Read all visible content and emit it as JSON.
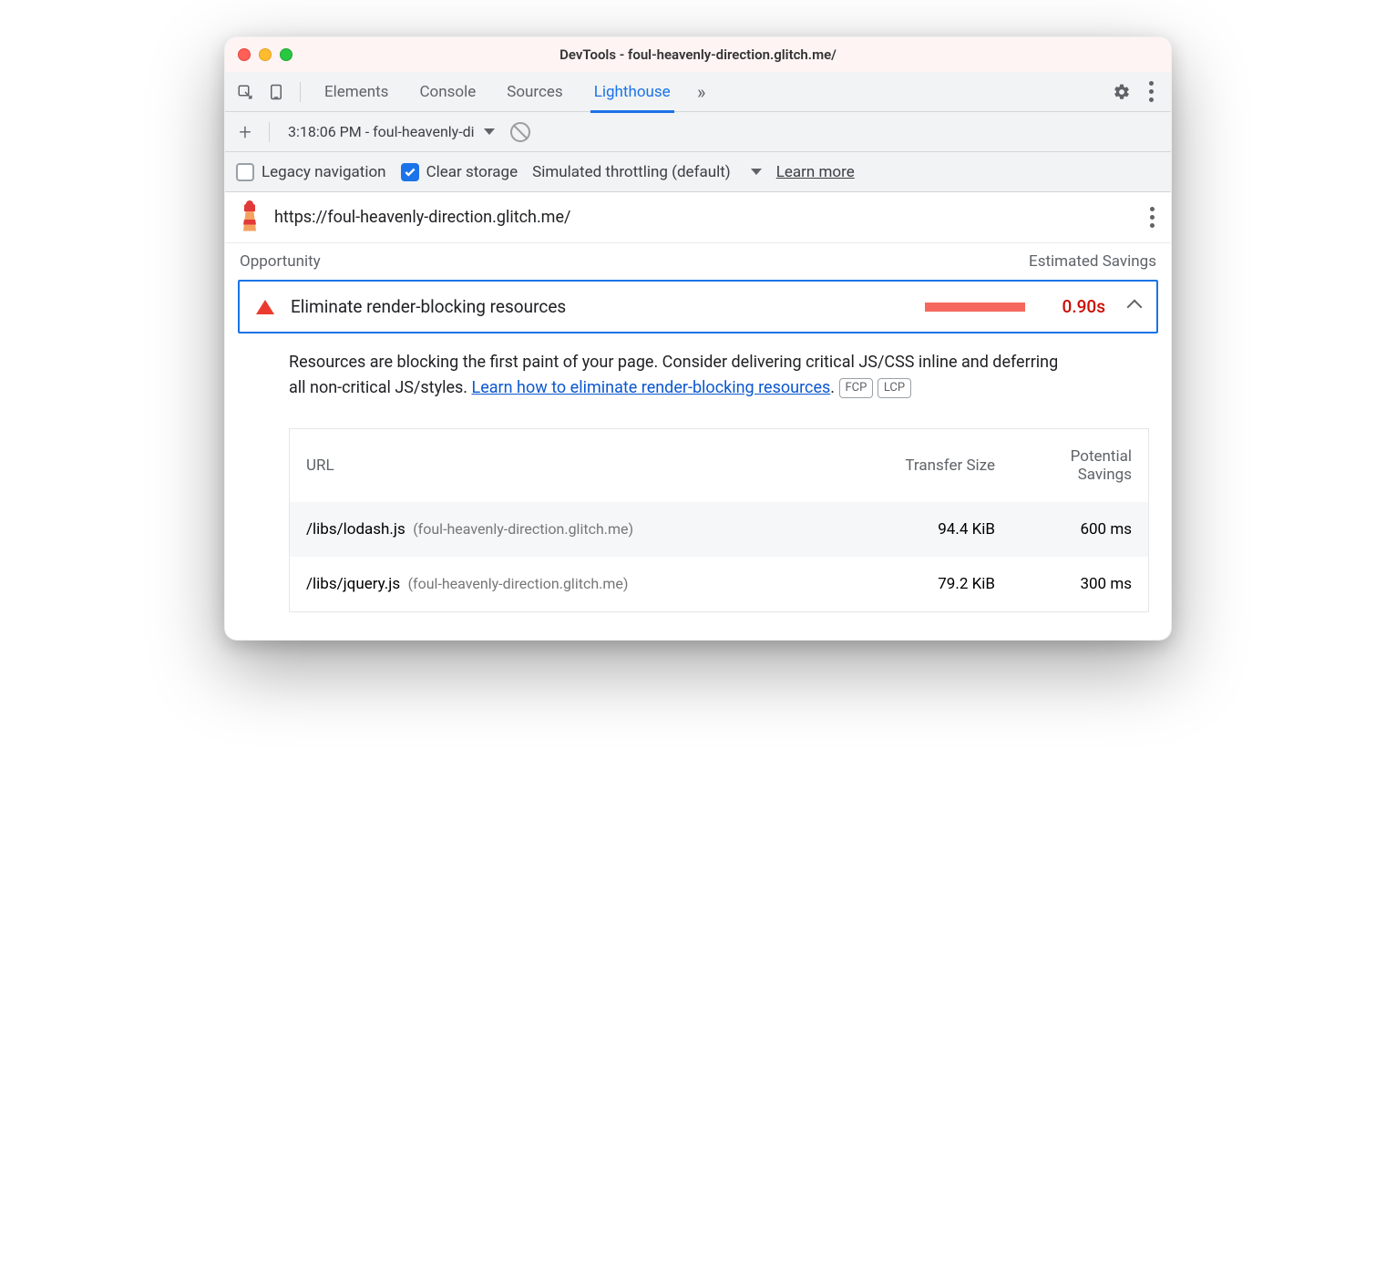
{
  "window": {
    "title": "DevTools - foul-heavenly-direction.glitch.me/"
  },
  "tabs": {
    "items": [
      {
        "label": "Elements",
        "active": false
      },
      {
        "label": "Console",
        "active": false
      },
      {
        "label": "Sources",
        "active": false
      },
      {
        "label": "Lighthouse",
        "active": true
      }
    ]
  },
  "subtoolbar": {
    "report_label": "3:18:06 PM - foul-heavenly-di"
  },
  "options": {
    "legacy_label": "Legacy navigation",
    "legacy_checked": false,
    "clear_label": "Clear storage",
    "clear_checked": true,
    "throttling_label": "Simulated throttling (default)",
    "learn_more": "Learn more"
  },
  "urlrow": {
    "url": "https://foul-heavenly-direction.glitch.me/"
  },
  "section": {
    "opportunity": "Opportunity",
    "est_savings": "Estimated Savings"
  },
  "opportunity": {
    "title": "Eliminate render-blocking resources",
    "value": "0.90s",
    "desc_pre": "Resources are blocking the first paint of your page. Consider delivering critical JS/CSS inline and deferring all non-critical JS/styles. ",
    "desc_link": "Learn how to eliminate render-blocking resources",
    "desc_post": ".",
    "badge1": "FCP",
    "badge2": "LCP"
  },
  "table": {
    "head_url": "URL",
    "head_size": "Transfer Size",
    "head_sav": "Potential Savings",
    "rows": [
      {
        "path": "/libs/lodash.js",
        "host": "(foul-heavenly-direction.glitch.me)",
        "size": "94.4 KiB",
        "savings": "600 ms"
      },
      {
        "path": "/libs/jquery.js",
        "host": "(foul-heavenly-direction.glitch.me)",
        "size": "79.2 KiB",
        "savings": "300 ms"
      }
    ]
  }
}
